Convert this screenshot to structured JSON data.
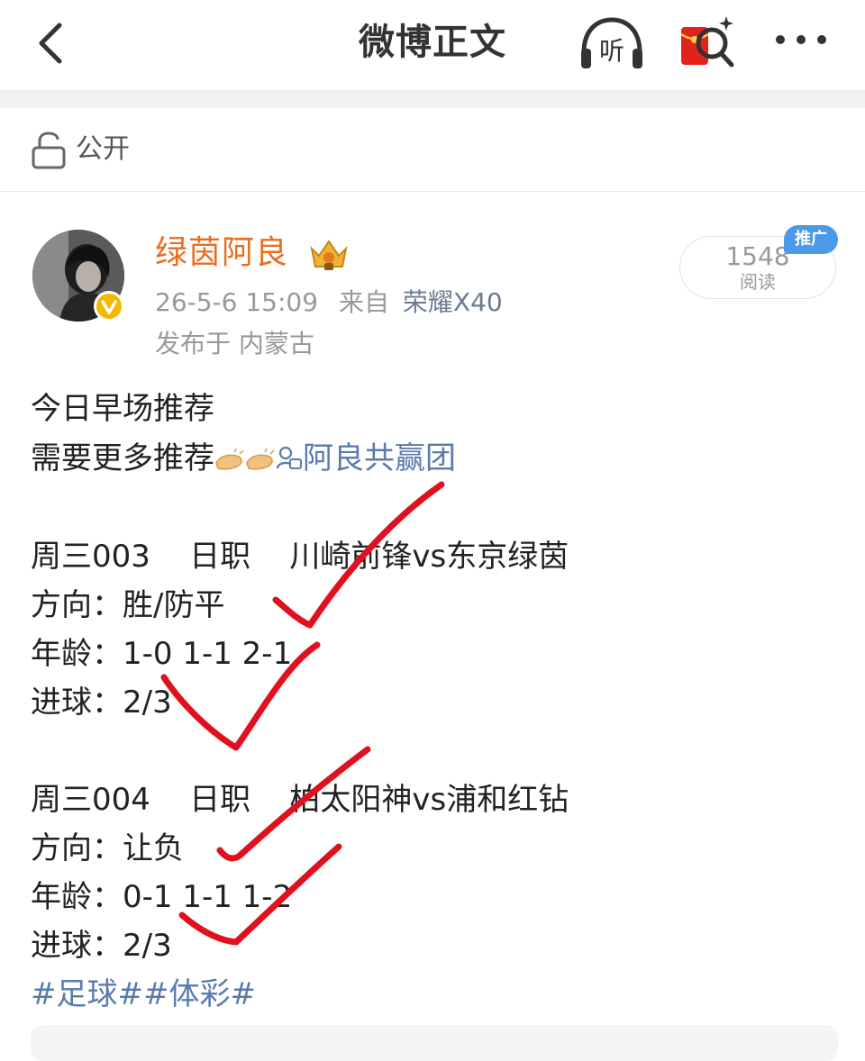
{
  "nav": {
    "title": "微博正文",
    "back_icon": "chevron-left-icon",
    "listen_icon": "headphones-icon",
    "listen_label": "听",
    "redpacket_icon": "red-packet-search-icon",
    "more_icon": "more-dots-icon"
  },
  "visibility": {
    "label": "公开",
    "icon": "lock-icon"
  },
  "post": {
    "author": "绿茵阿良",
    "time": "26-5-6 15:09",
    "from_label": "来自",
    "device": "荣耀X40",
    "location": "发布于 内蒙古",
    "reads_count": "1548",
    "reads_label": "阅读",
    "promo_badge": "推广",
    "lines": {
      "l1": "今日早场推荐",
      "l2": "需要更多推荐",
      "l2_link": "阿良共赢团",
      "m1_header": "周三003    日职    川崎前锋vs东京绿茵",
      "m1_dir": "方向：胜/防平",
      "m1_age": "年龄：1-0 1-1 2-1",
      "m1_goals": "进球：2/3",
      "m2_header": "周三004    日职    柏太阳神vs浦和红钻",
      "m2_dir": "方向：让负",
      "m2_age": "年龄：0-1 1-1 1-2",
      "m2_goals": "进球：2/3",
      "tags": "#足球##体彩#"
    }
  },
  "colors": {
    "author": "#e86e20",
    "link": "#5b7bab",
    "check": "#e0101e",
    "promo": "#4a9ae8"
  }
}
